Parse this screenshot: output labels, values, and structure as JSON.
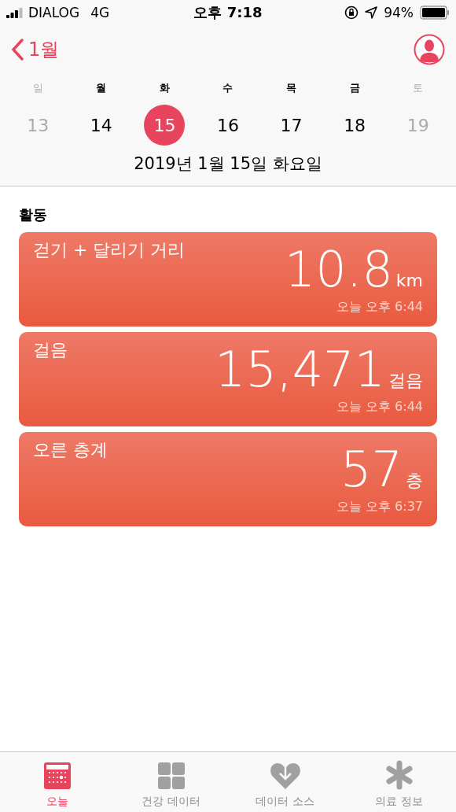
{
  "status_bar": {
    "carrier": "DIALOG",
    "network": "4G",
    "time": "오후 7:18",
    "battery": "94%"
  },
  "nav": {
    "back": "1월"
  },
  "week": [
    {
      "weekday": "일",
      "day": "13",
      "dimmed": true,
      "selected": false
    },
    {
      "weekday": "월",
      "day": "14",
      "dimmed": false,
      "selected": false
    },
    {
      "weekday": "화",
      "day": "15",
      "dimmed": false,
      "selected": true
    },
    {
      "weekday": "수",
      "day": "16",
      "dimmed": false,
      "selected": false
    },
    {
      "weekday": "목",
      "day": "17",
      "dimmed": false,
      "selected": false
    },
    {
      "weekday": "금",
      "day": "18",
      "dimmed": false,
      "selected": false
    },
    {
      "weekday": "토",
      "day": "19",
      "dimmed": true,
      "selected": false
    }
  ],
  "date_label": "2019년 1월 15일 화요일",
  "section_title": "활동",
  "cards": [
    {
      "title": "걷기 + 달리기 거리",
      "value": "10.8",
      "unit": "km",
      "time": "오늘 오후 6:44"
    },
    {
      "title": "걸음",
      "value": "15,471",
      "unit": "걸음",
      "time": "오늘 오후 6:44"
    },
    {
      "title": "오른 층계",
      "value": "57",
      "unit": "층",
      "time": "오늘 오후 6:37"
    }
  ],
  "tabs": [
    {
      "kind": "today",
      "label": "오늘",
      "selected": true
    },
    {
      "kind": "grid",
      "label": "건강 데이터",
      "selected": false
    },
    {
      "kind": "heart",
      "label": "데이터 소스",
      "selected": false
    },
    {
      "kind": "asterisk",
      "label": "의료 정보",
      "selected": false
    }
  ]
}
